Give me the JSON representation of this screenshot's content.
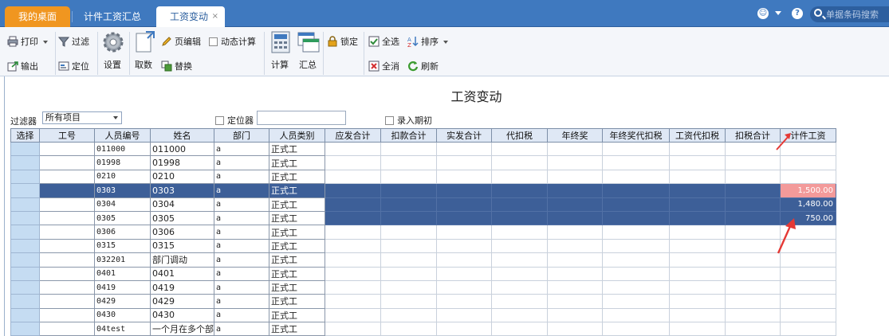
{
  "tabs": [
    {
      "label": "我的桌面",
      "key": "home"
    },
    {
      "label": "计件工资汇总",
      "key": "piece"
    },
    {
      "label": "工资变动",
      "key": "active"
    }
  ],
  "tab_close_glyph": "×",
  "search": {
    "placeholder": "单据条码搜索"
  },
  "toolbar": {
    "print": "打印",
    "export": "输出",
    "filter": "过滤",
    "locate": "定位",
    "settings": "设置",
    "fetch": "取数",
    "page_edit": "页编辑",
    "replace": "替换",
    "dynamic_calc": "动态计算",
    "calculate": "计算",
    "summary": "汇总",
    "lock": "锁定",
    "select_all": "全选",
    "deselect_all": "全消",
    "sort": "排序",
    "refresh": "刷新"
  },
  "page_title": "工资变动",
  "filter": {
    "label": "过滤器",
    "selected": "所有项目"
  },
  "locator": {
    "label": "定位器",
    "value": ""
  },
  "opening_entry": {
    "label": "录入期初"
  },
  "grid": {
    "columns": [
      "选择",
      "工号",
      "人员编号",
      "姓名",
      "部门",
      "人员类别",
      "应发合计",
      "扣款合计",
      "实发合计",
      "代扣税",
      "年终奖",
      "年终奖代扣税",
      "工资代扣税",
      "扣税合计",
      "计件工资"
    ],
    "rows": [
      {
        "id": "011000",
        "name": "011000",
        "dept": "a",
        "type": "正式工",
        "piece": ""
      },
      {
        "id": "01998",
        "name": "01998",
        "dept": "a",
        "type": "正式工",
        "piece": ""
      },
      {
        "id": "0210",
        "name": "0210",
        "dept": "a",
        "type": "正式工",
        "piece": ""
      },
      {
        "id": "0303",
        "name": "0303",
        "dept": "a",
        "type": "正式工",
        "piece": "1,500.00"
      },
      {
        "id": "0304",
        "name": "0304",
        "dept": "a",
        "type": "正式工",
        "piece": "1,480.00"
      },
      {
        "id": "0305",
        "name": "0305",
        "dept": "a",
        "type": "正式工",
        "piece": "750.00"
      },
      {
        "id": "0306",
        "name": "0306",
        "dept": "a",
        "type": "正式工",
        "piece": ""
      },
      {
        "id": "0315",
        "name": "0315",
        "dept": "a",
        "type": "正式工",
        "piece": ""
      },
      {
        "id": "032201",
        "name": "部门调动",
        "dept": "a",
        "type": "正式工",
        "piece": ""
      },
      {
        "id": "0401",
        "name": "0401",
        "dept": "a",
        "type": "正式工",
        "piece": ""
      },
      {
        "id": "0419",
        "name": "0419",
        "dept": "a",
        "type": "正式工",
        "piece": ""
      },
      {
        "id": "0429",
        "name": "0429",
        "dept": "a",
        "type": "正式工",
        "piece": ""
      },
      {
        "id": "0430",
        "name": "0430",
        "dept": "a",
        "type": "正式工",
        "piece": ""
      },
      {
        "id": "04test",
        "name": "一个月在多个部",
        "dept": "a",
        "type": "正式工",
        "piece": ""
      }
    ]
  },
  "colors": {
    "tabbar": "#3f79bf",
    "home_tab": "#f09620",
    "selected_row": "#3d5f98",
    "highlight_cell": "#f39a9a",
    "arrow": "#e53935"
  }
}
